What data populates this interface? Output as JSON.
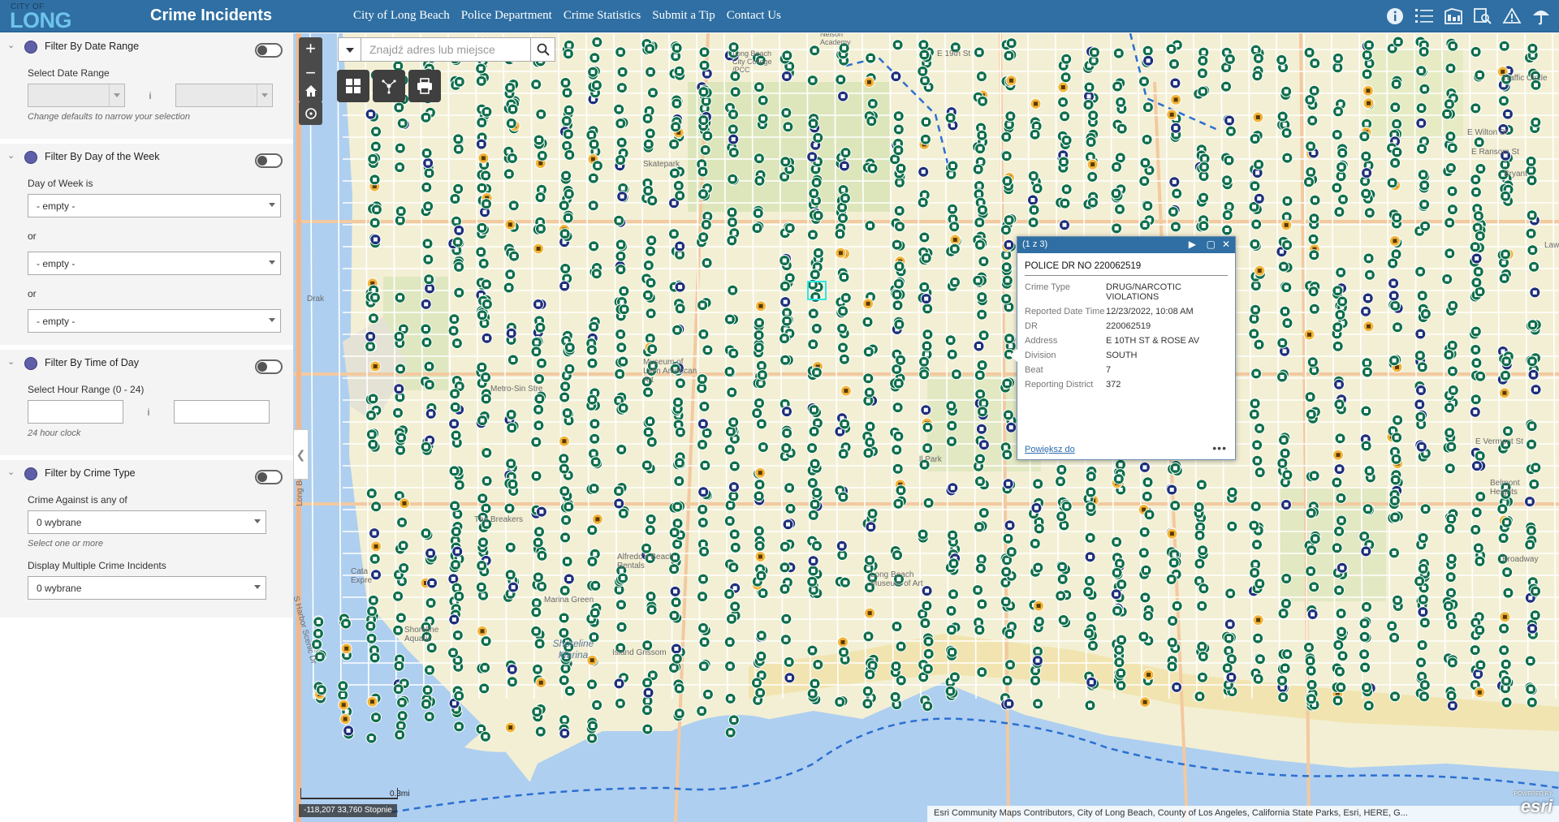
{
  "header": {
    "logo_small": "CITY OF",
    "logo_main": "LONG BEACH",
    "title": "Crime Incidents",
    "nav": [
      "City of Long Beach",
      "Police Department",
      "Crime Statistics",
      "Submit a Tip",
      "Contact Us"
    ],
    "icons": [
      "info-icon",
      "list-icon",
      "layers-icon",
      "search-person-icon",
      "alert-icon",
      "umbrella-icon"
    ]
  },
  "filters": {
    "date": {
      "title": "Filter By Date Range",
      "label": "Select Date Range",
      "separator": "i",
      "hint": "Change defaults to narrow your selection"
    },
    "day": {
      "title": "Filter By Day of the Week",
      "label": "Day of Week is",
      "or": "or",
      "options": [
        "- empty -",
        "- empty -",
        "- empty -"
      ]
    },
    "time": {
      "title": "Filter By Time of Day",
      "label": "Select Hour Range (0 - 24)",
      "separator": "i",
      "hint": "24 hour clock"
    },
    "crime": {
      "title": "Filter by Crime Type",
      "label": "Crime Against is any of",
      "value": "0 wybrane",
      "hint": "Select one or more",
      "label2": "Display Multiple Crime Incidents",
      "value2": "0 wybrane"
    }
  },
  "map": {
    "search_placeholder": "Znajdź adres lub miejsce",
    "scale_label": "0.3mi",
    "coords": "-118,207 33,760 Stopnie",
    "attribution": "Esri Community Maps Contributors, City of Long Beach, County of Los Angeles, California State Parks, Esri, HERE, G...",
    "powered": "POWERED BY",
    "esri": "esri",
    "labels": {
      "l1": "E 19th St",
      "l2": "Long Beach City College /PCC",
      "l3": "Traffic Circle",
      "l4": "E Wilton St",
      "l5": "E Ransom St",
      "l6": "Bryant",
      "l7": "Skatepark",
      "l8": "Metro-Sin Stre",
      "l9": "Museum of Latin American Art",
      "l10": "ll Park",
      "l11": "The Breakers",
      "l12": "Alfredo's Beach Rentals",
      "l13": "Marina Green",
      "l14": "Shoreline Aquatic",
      "l15": "Shoreline Marina",
      "l16": "Island Grissom",
      "l17": "Broadway",
      "l18": "Long Beach Museum of Art",
      "l19": "Belmont Heights",
      "l20": "Long Beach Fwy",
      "l21": "S Harbor Scenic Dr",
      "l22": "E Vermont St",
      "l23": "Nelson Academy",
      "l24": "Lawn",
      "l25": "Cata Expre",
      "l26": "Drak"
    }
  },
  "popup": {
    "counter": "(1 z 3)",
    "title": "POLICE DR NO 220062519",
    "rows": [
      {
        "k": "Crime Type",
        "v": "DRUG/NARCOTIC VIOLATIONS"
      },
      {
        "k": "Reported Date Time",
        "v": "12/23/2022, 10:08 AM"
      },
      {
        "k": "DR",
        "v": "220062519"
      },
      {
        "k": "Address",
        "v": "E 10TH ST & ROSE AV"
      },
      {
        "k": "Division",
        "v": "SOUTH"
      },
      {
        "k": "Beat",
        "v": "7"
      },
      {
        "k": "Reporting District",
        "v": "372"
      }
    ],
    "zoom_link": "Powiększ do",
    "more": "•••"
  },
  "colors": {
    "header_bg": "#2f6fa3",
    "marker_green": "#0e6e4a",
    "marker_navy": "#1d2f7a",
    "marker_orange": "#f2b53a",
    "water": "#aecff0",
    "land": "#f3efd4"
  }
}
